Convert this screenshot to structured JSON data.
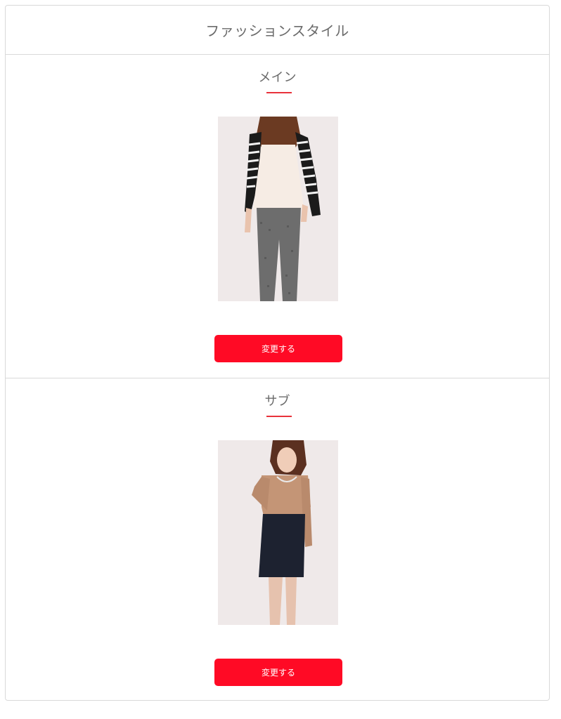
{
  "card": {
    "title": "ファッションスタイル"
  },
  "sections": [
    {
      "title": "メイン",
      "button_label": "変更する",
      "photo": "woman-striped-cardigan-photo"
    },
    {
      "title": "サブ",
      "button_label": "変更する",
      "photo": "woman-beige-blouse-navy-skirt-photo"
    }
  ],
  "colors": {
    "accent": "#ff0a25",
    "underline": "#e8323b",
    "border": "#d9d9d9",
    "text": "#6b6b6b"
  }
}
